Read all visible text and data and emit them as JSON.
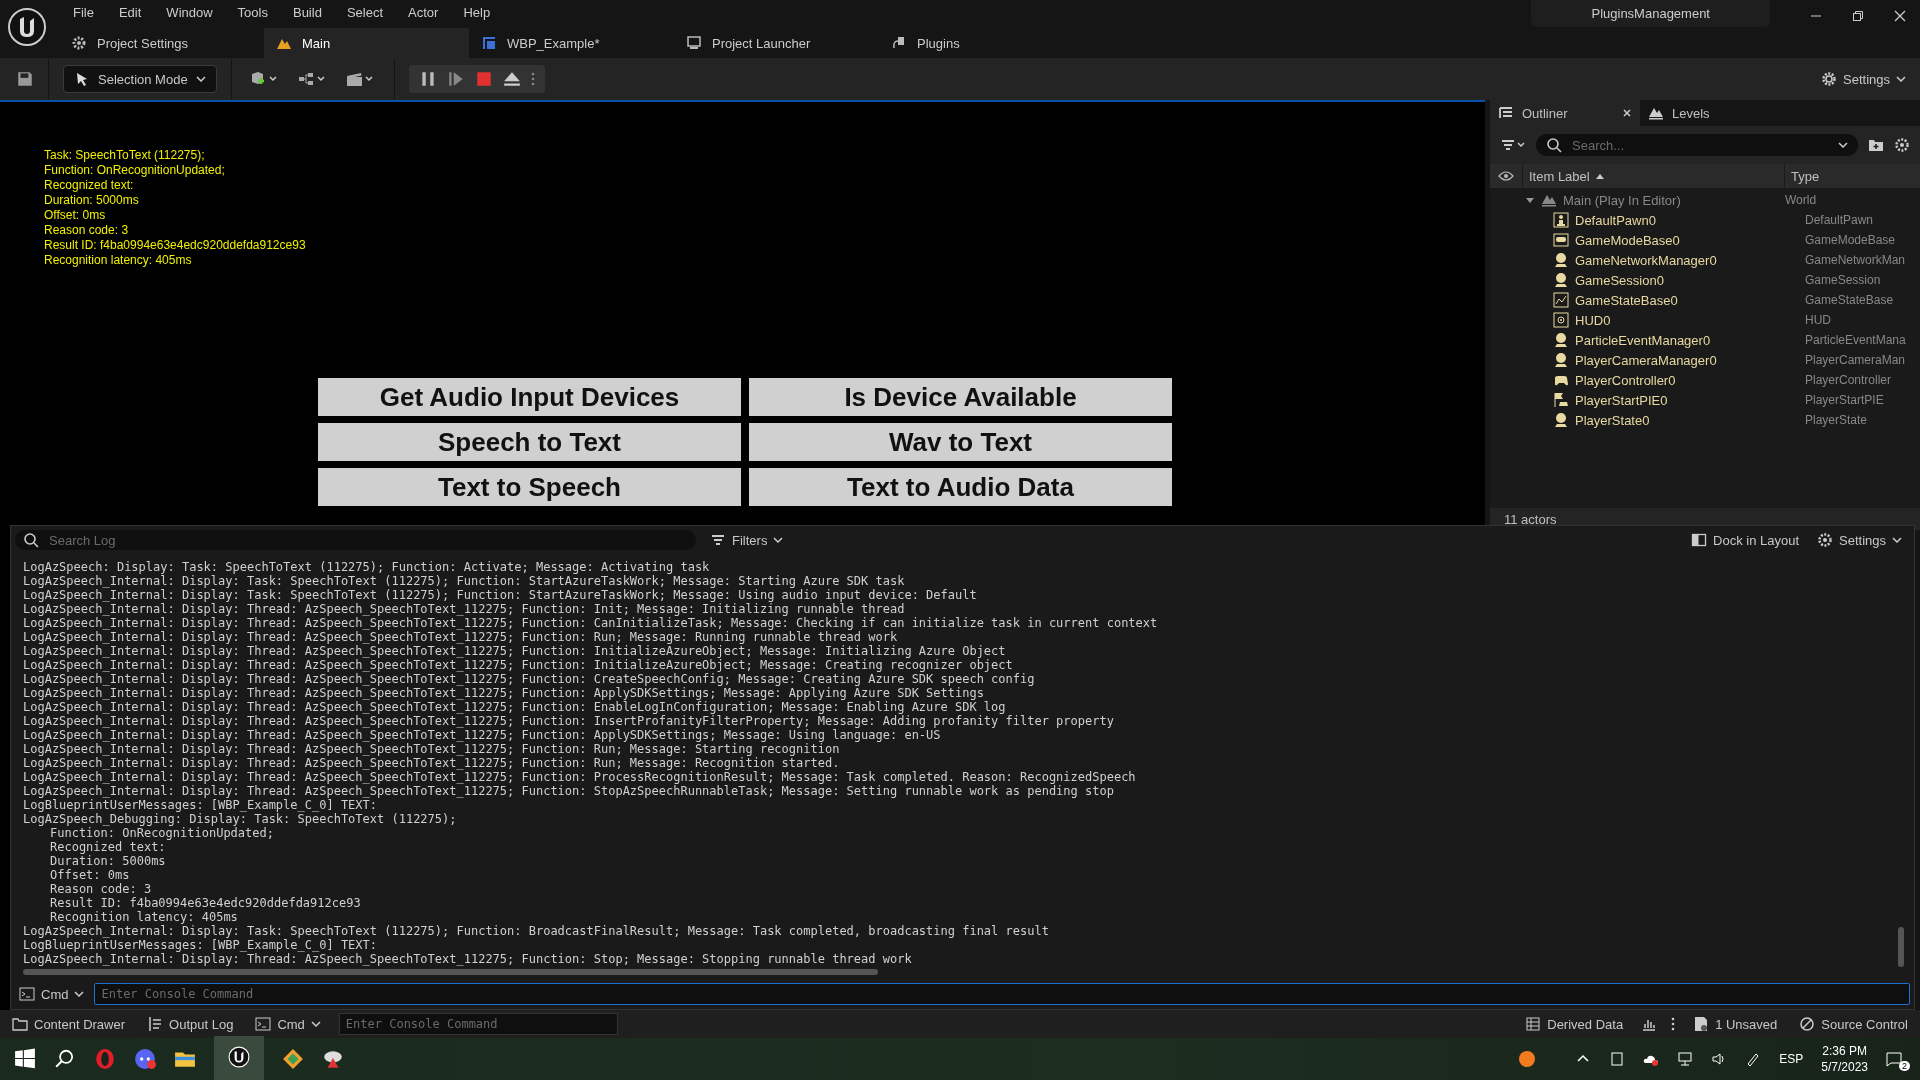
{
  "menu": [
    "File",
    "Edit",
    "Window",
    "Tools",
    "Build",
    "Select",
    "Actor",
    "Help"
  ],
  "project_name": "PluginsManagement",
  "tabs": [
    {
      "label": "Project Settings",
      "kind": "settings",
      "selected": false
    },
    {
      "label": "Main",
      "kind": "level",
      "selected": true
    },
    {
      "label": "WBP_Example*",
      "kind": "widget",
      "selected": false
    },
    {
      "label": "Project Launcher",
      "kind": "launcher",
      "selected": false
    },
    {
      "label": "Plugins",
      "kind": "plugin",
      "selected": false
    }
  ],
  "toolbar": {
    "mode": "Selection Mode",
    "settings": "Settings"
  },
  "viewport": {
    "overlay_lines": [
      "Task: SpeechToText (112275);",
      "Function: OnRecognitionUpdated;",
      "Recognized text:",
      "Duration: 5000ms",
      "Offset: 0ms",
      "Reason code: 3",
      "Result ID: f4ba0994e63e4edc920ddefda912ce93",
      "Recognition latency: 405ms"
    ],
    "buttons": [
      "Get Audio Input Devices",
      "Is Device Available",
      "Speech to Text",
      "Wav to Text",
      "Text to Speech",
      "Text to Audio Data"
    ]
  },
  "outliner": {
    "tabs": [
      {
        "label": "Outliner",
        "selected": true
      },
      {
        "label": "Levels",
        "selected": false
      }
    ],
    "search": {
      "placeholder": "Search..."
    },
    "columns": [
      "Item Label",
      "Type"
    ],
    "tree": [
      {
        "label": "Main (Play In Editor)",
        "type": "World",
        "kind": "world",
        "expanded": true,
        "children": [
          {
            "label": "DefaultPawn0",
            "type": "DefaultPawn",
            "kind": "pawn"
          },
          {
            "label": "GameModeBase0",
            "type": "GameModeBase",
            "kind": "gamemode"
          },
          {
            "label": "GameNetworkManager0",
            "type": "GameNetworkMan",
            "kind": "actor"
          },
          {
            "label": "GameSession0",
            "type": "GameSession",
            "kind": "actor"
          },
          {
            "label": "GameStateBase0",
            "type": "GameStateBase",
            "kind": "graph"
          },
          {
            "label": "HUD0",
            "type": "HUD",
            "kind": "hud"
          },
          {
            "label": "ParticleEventManager0",
            "type": "ParticleEventMana",
            "kind": "actor"
          },
          {
            "label": "PlayerCameraManager0",
            "type": "PlayerCameraMan",
            "kind": "actor"
          },
          {
            "label": "PlayerController0",
            "type": "PlayerController",
            "kind": "controller"
          },
          {
            "label": "PlayerStartPIE0",
            "type": "PlayerStartPIE",
            "kind": "start"
          },
          {
            "label": "PlayerState0",
            "type": "PlayerState",
            "kind": "actor"
          }
        ]
      }
    ],
    "footer": "11 actors"
  },
  "output_log": {
    "search": {
      "placeholder": "Search Log"
    },
    "filters": "Filters",
    "dock": "Dock in Layout",
    "settings": "Settings",
    "lines": [
      {
        "text": "LogAzSpeech: Display: Task: SpeechToText (112275); Function: Activate; Message: Activating task",
        "indent": false
      },
      {
        "text": "LogAzSpeech_Internal: Display: Task: SpeechToText (112275); Function: StartAzureTaskWork; Message: Starting Azure SDK task",
        "indent": false
      },
      {
        "text": "LogAzSpeech_Internal: Display: Task: SpeechToText (112275); Function: StartAzureTaskWork; Message: Using audio input device: Default",
        "indent": false
      },
      {
        "text": "LogAzSpeech_Internal: Display: Thread: AzSpeech_SpeechToText_112275; Function: Init; Message: Initializing runnable thread",
        "indent": false
      },
      {
        "text": "LogAzSpeech_Internal: Display: Thread: AzSpeech_SpeechToText_112275; Function: CanInitializeTask; Message: Checking if can initialize task in current context",
        "indent": false
      },
      {
        "text": "LogAzSpeech_Internal: Display: Thread: AzSpeech_SpeechToText_112275; Function: Run; Message: Running runnable thread work",
        "indent": false
      },
      {
        "text": "LogAzSpeech_Internal: Display: Thread: AzSpeech_SpeechToText_112275; Function: InitializeAzureObject; Message: Initializing Azure Object",
        "indent": false
      },
      {
        "text": "LogAzSpeech_Internal: Display: Thread: AzSpeech_SpeechToText_112275; Function: InitializeAzureObject; Message: Creating recognizer object",
        "indent": false
      },
      {
        "text": "LogAzSpeech_Internal: Display: Thread: AzSpeech_SpeechToText_112275; Function: CreateSpeechConfig; Message: Creating Azure SDK speech config",
        "indent": false
      },
      {
        "text": "LogAzSpeech_Internal: Display: Thread: AzSpeech_SpeechToText_112275; Function: ApplySDKSettings; Message: Applying Azure SDK Settings",
        "indent": false
      },
      {
        "text": "LogAzSpeech_Internal: Display: Thread: AzSpeech_SpeechToText_112275; Function: EnableLogInConfiguration; Message: Enabling Azure SDK log",
        "indent": false
      },
      {
        "text": "LogAzSpeech_Internal: Display: Thread: AzSpeech_SpeechToText_112275; Function: InsertProfanityFilterProperty; Message: Adding profanity filter property",
        "indent": false
      },
      {
        "text": "LogAzSpeech_Internal: Display: Thread: AzSpeech_SpeechToText_112275; Function: ApplySDKSettings; Message: Using language: en-US",
        "indent": false
      },
      {
        "text": "LogAzSpeech_Internal: Display: Thread: AzSpeech_SpeechToText_112275; Function: Run; Message: Starting recognition",
        "indent": false
      },
      {
        "text": "LogAzSpeech_Internal: Display: Thread: AzSpeech_SpeechToText_112275; Function: Run; Message: Recognition started.",
        "indent": false
      },
      {
        "text": "LogAzSpeech_Internal: Display: Thread: AzSpeech_SpeechToText_112275; Function: ProcessRecognitionResult; Message: Task completed. Reason: RecognizedSpeech",
        "indent": false
      },
      {
        "text": "LogAzSpeech_Internal: Display: Thread: AzSpeech_SpeechToText_112275; Function: StopAzSpeechRunnableTask; Message: Setting runnable work as pending stop",
        "indent": false
      },
      {
        "text": "LogBlueprintUserMessages: [WBP_Example_C_0] TEXT:",
        "indent": false
      },
      {
        "text": "LogAzSpeech_Debugging: Display: Task: SpeechToText (112275);",
        "indent": false
      },
      {
        "text": "Function: OnRecognitionUpdated;",
        "indent": true
      },
      {
        "text": "Recognized text:",
        "indent": true
      },
      {
        "text": "Duration: 5000ms",
        "indent": true
      },
      {
        "text": "Offset: 0ms",
        "indent": true
      },
      {
        "text": "Reason code: 3",
        "indent": true
      },
      {
        "text": "Result ID: f4ba0994e63e4edc920ddefda912ce93",
        "indent": true
      },
      {
        "text": "Recognition latency: 405ms",
        "indent": true
      },
      {
        "text": "LogAzSpeech_Internal: Display: Task: SpeechToText (112275); Function: BroadcastFinalResult; Message: Task completed, broadcasting final result",
        "indent": false
      },
      {
        "text": "LogBlueprintUserMessages: [WBP_Example_C_0] TEXT:",
        "indent": false
      },
      {
        "text": "LogAzSpeech_Internal: Display: Thread: AzSpeech_SpeechToText_112275; Function: Stop; Message: Stopping runnable thread work",
        "indent": false
      }
    ],
    "cmd": "Cmd",
    "console": {
      "placeholder": "Enter Console Command"
    }
  },
  "status_bar": {
    "content_drawer": "Content Drawer",
    "output_log": "Output Log",
    "cmd": "Cmd",
    "console": {
      "placeholder": "Enter Console Command"
    },
    "derived_data": "Derived Data",
    "unsaved": "1 Unsaved",
    "source_control": "Source Control"
  },
  "taskbar": {
    "language": "ESP",
    "time": "2:36 PM",
    "date": "5/7/2023",
    "notifications": "2"
  }
}
